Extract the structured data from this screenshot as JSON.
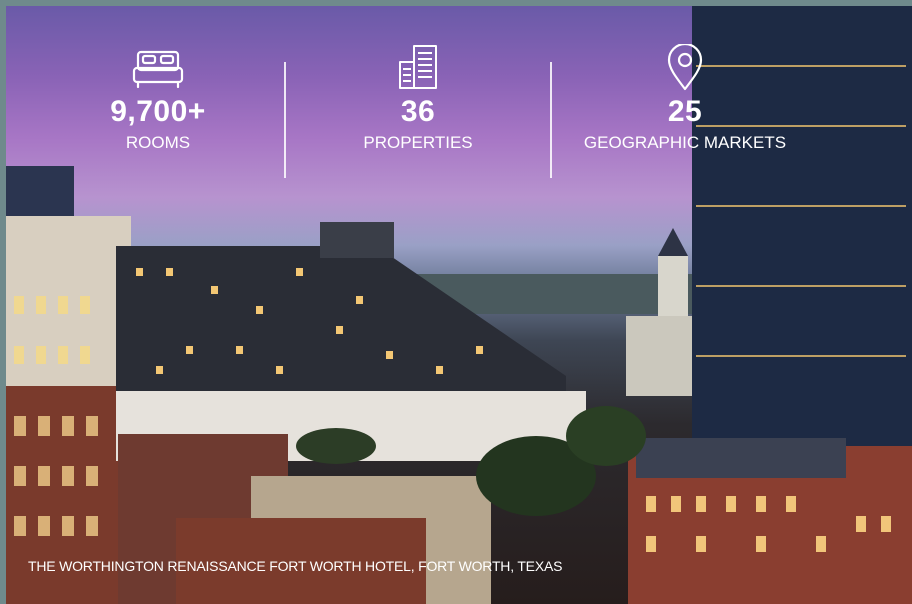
{
  "stats": [
    {
      "icon": "bed-icon",
      "value": "9,700+",
      "label": "ROOMS"
    },
    {
      "icon": "building-icon",
      "value": "36",
      "label": "PROPERTIES"
    },
    {
      "icon": "location-pin-icon",
      "value": "25",
      "label": "GEOGRAPHIC MARKETS"
    }
  ],
  "caption": "THE WORTHINGTON RENAISSANCE FORT WORTH HOTEL, FORT WORTH, TEXAS",
  "colors": {
    "text": "#ffffff",
    "sky_top": "#6a5aa8",
    "sky_mid": "#b793cf",
    "frame": "#6f8a8c"
  }
}
